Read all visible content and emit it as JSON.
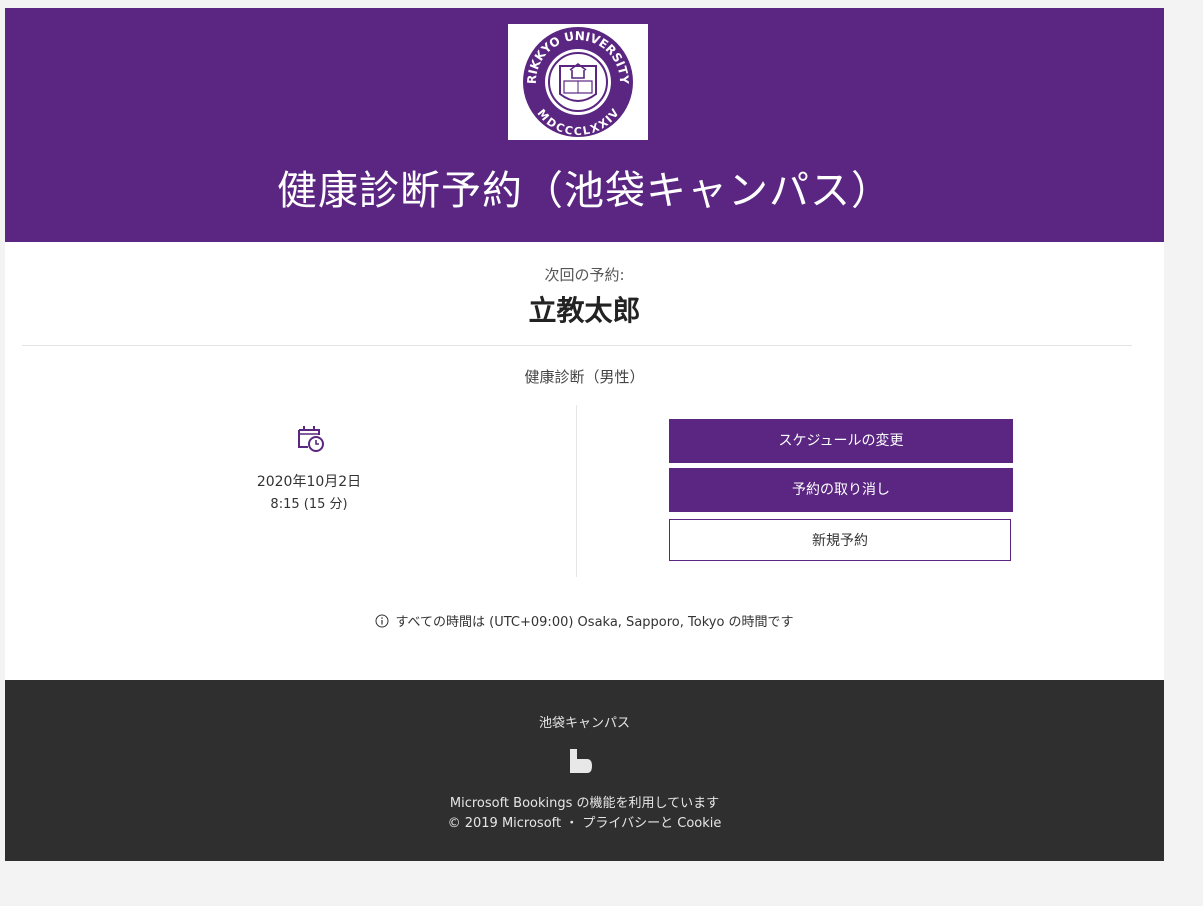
{
  "header": {
    "title": "健康診断予約（池袋キャンパス）",
    "logo_text_top": "RIKKYO UNIVERSITY",
    "logo_text_bottom": "MDCCCLXXIV",
    "brand_color": "#5a2681"
  },
  "appointment": {
    "next_label": "次回の予約:",
    "customer_name": "立教太郎",
    "service": "健康診断（男性）",
    "date": "2020年10月2日",
    "time": "8:15 (15 分)",
    "calendar_icon": "calendar-clock-icon"
  },
  "actions": {
    "reschedule": "スケジュールの変更",
    "cancel": "予約の取り消し",
    "new_booking": "新規予約"
  },
  "timezone": {
    "icon": "info-icon",
    "text": "すべての時間は (UTC+09:00) Osaka, Sapporo, Tokyo の時間です"
  },
  "footer": {
    "business_name": "池袋キャンパス",
    "logo_icon": "microsoft-bookings-icon",
    "powered_by": "Microsoft Bookings の機能を利用しています",
    "copyright": "© 2019 Microsoft",
    "separator": "・",
    "privacy_link": "プライバシーと Cookie"
  }
}
